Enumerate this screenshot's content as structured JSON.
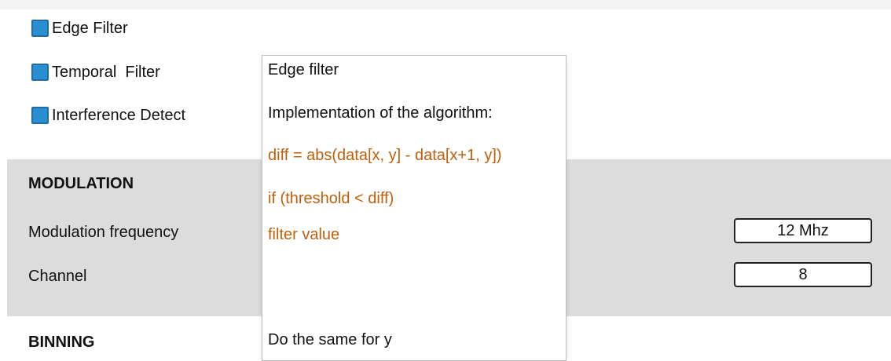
{
  "filters": [
    {
      "label": "Edge Filter",
      "checked": true
    },
    {
      "label": "Temporal  Filter",
      "checked": true
    },
    {
      "label": "Interference Detect",
      "checked": true
    }
  ],
  "modulation": {
    "title": "MODULATION",
    "frequency_label": "Modulation frequency",
    "frequency_value": "12 Mhz",
    "channel_label": "Channel",
    "channel_value": "8"
  },
  "binning": {
    "title": "BINNING"
  },
  "tooltip": {
    "title": "Edge filter",
    "intro": "Implementation of the algorithm:",
    "code": [
      "diff = abs(data[x, y] - data[x+1, y])",
      "if (threshold < diff)",
      "filter value"
    ],
    "footer": "Do the same for y"
  },
  "colors": {
    "checkbox": "#2a8fd0",
    "section_background": "#dcdcdc",
    "code_text": "#c0600b"
  }
}
